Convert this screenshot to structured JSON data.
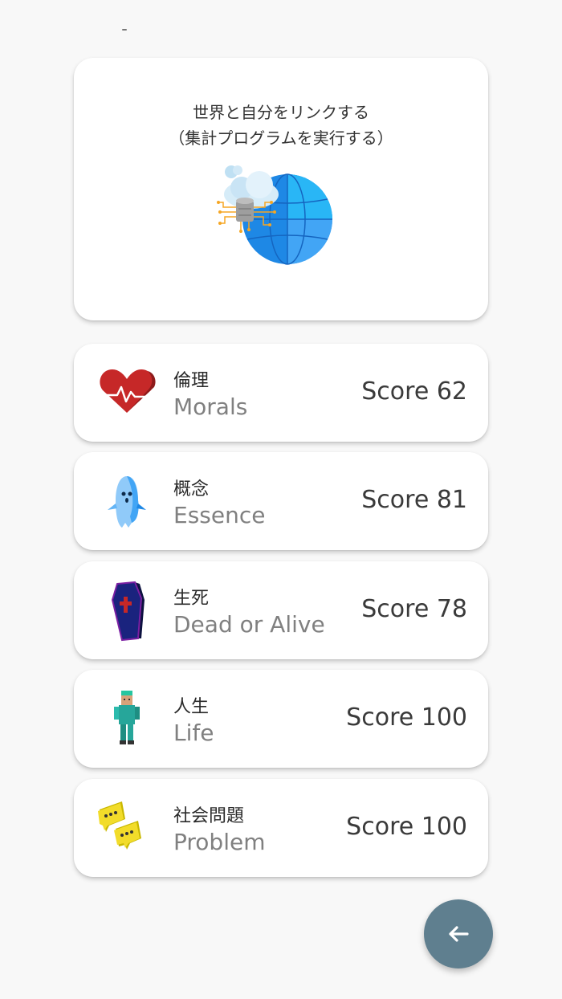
{
  "hero": {
    "line1": "世界と自分をリンクする",
    "line2": "（集計プログラムを実行する）",
    "icon": "cloud-globe-network-icon"
  },
  "categories": [
    {
      "jp": "倫理",
      "en": "Morals",
      "score_label": "Score 62",
      "icon": "heart-pulse-icon"
    },
    {
      "jp": "概念",
      "en": "Essence",
      "score_label": "Score 81",
      "icon": "ghost-icon"
    },
    {
      "jp": "生死",
      "en": "Dead or Alive",
      "score_label": "Score 78",
      "icon": "coffin-icon"
    },
    {
      "jp": "人生",
      "en": "Life",
      "score_label": "Score 100",
      "icon": "person-icon"
    },
    {
      "jp": "社会問題",
      "en": "Problem",
      "score_label": "Score 100",
      "icon": "chat-bubbles-icon"
    }
  ],
  "fab": {
    "icon": "arrow-left-icon"
  }
}
